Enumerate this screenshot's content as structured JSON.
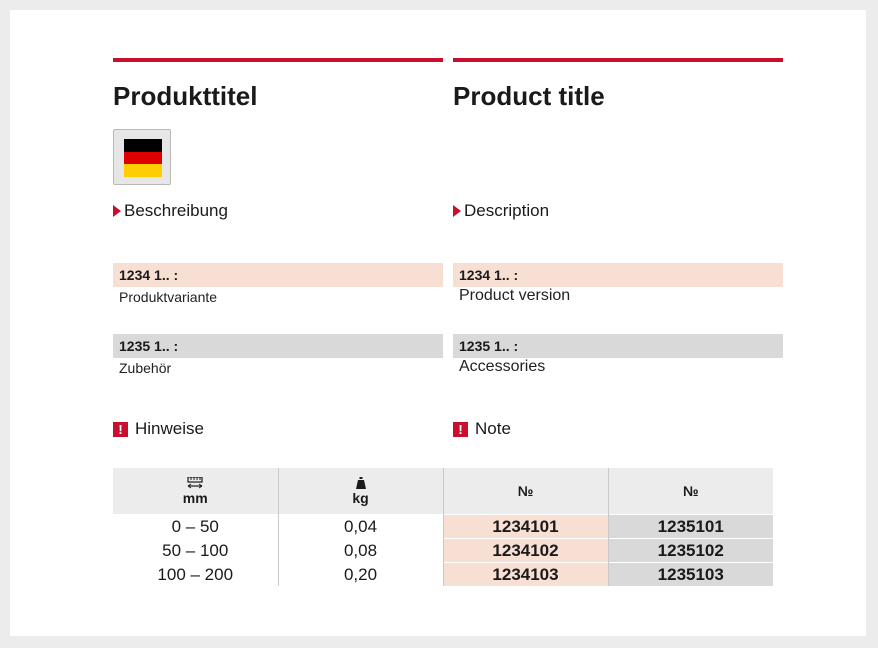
{
  "de": {
    "title": "Produkttitel",
    "description": "Beschreibung",
    "variant1_code": "1234 1.. :",
    "variant1_text": "Produktvariante",
    "variant2_code": "1235 1.. :",
    "variant2_text": "Zubehör",
    "note": "Hinweise"
  },
  "en": {
    "title": "Product title",
    "description": "Description",
    "variant1_code": "1234 1.. :",
    "variant1_text": "Product version",
    "variant2_code": "1235 1.. :",
    "variant2_text": "Accessories",
    "note": "Note"
  },
  "flag": {
    "country": "Germany",
    "colors": [
      "#000000",
      "#dd0000",
      "#ffce00"
    ]
  },
  "icons": {
    "length": "ruler-icon",
    "weight": "weight-icon",
    "note": "exclamation-icon",
    "bullet": "triangle-right-icon"
  },
  "accent_color": "#c8102e",
  "table": {
    "headers": [
      "mm",
      "kg",
      "№",
      "№"
    ],
    "rows": [
      [
        "0 – 50",
        "0,04",
        "1234101",
        "1235101"
      ],
      [
        "50 – 100",
        "0,08",
        "1234102",
        "1235102"
      ],
      [
        "100 – 200",
        "0,20",
        "1234103",
        "1235103"
      ]
    ]
  }
}
